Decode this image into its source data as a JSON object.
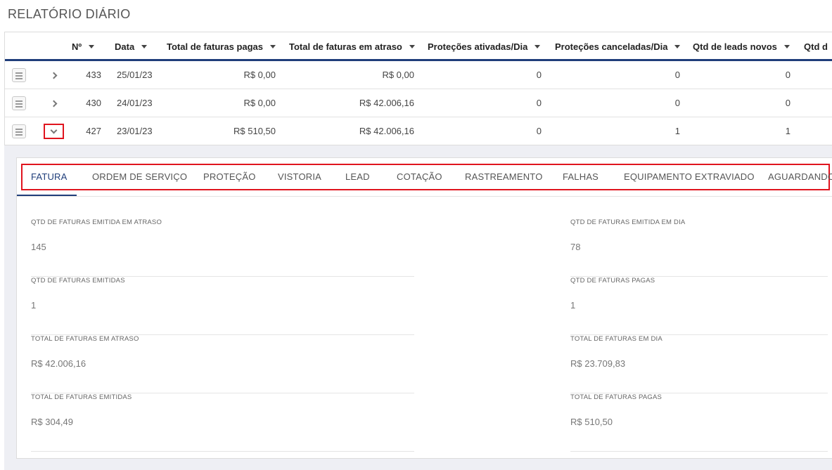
{
  "page": {
    "title": "RELATÓRIO DIÁRIO"
  },
  "table": {
    "columns": [
      "Nº",
      "Data",
      "Total de faturas pagas",
      "Total de faturas em atraso",
      "Proteções ativadas/Dia",
      "Proteções canceladas/Dia",
      "Qtd de leads novos",
      "Qtd d"
    ],
    "rows": [
      {
        "num": "433",
        "date": "25/01/23",
        "paid": "R$ 0,00",
        "late": "R$ 0,00",
        "activated": "0",
        "canceled": "0",
        "leads": "0",
        "expanded": false
      },
      {
        "num": "430",
        "date": "24/01/23",
        "paid": "R$ 0,00",
        "late": "R$ 42.006,16",
        "activated": "0",
        "canceled": "0",
        "leads": "0",
        "expanded": false
      },
      {
        "num": "427",
        "date": "23/01/23",
        "paid": "R$ 510,50",
        "late": "R$ 42.006,16",
        "activated": "0",
        "canceled": "1",
        "leads": "1",
        "expanded": true
      }
    ],
    "icons": {
      "row_menu": "hamburger-icon",
      "collapsed": "chevron-right-icon",
      "expanded": "chevron-down-icon",
      "sort": "caret-down-icon"
    }
  },
  "detail": {
    "tabs": [
      "FATURA",
      "ORDEM DE SERVIÇO",
      "PROTEÇÃO",
      "VISTORIA",
      "LEAD",
      "COTAÇÃO",
      "RASTREAMENTO",
      "FALHAS",
      "EQUIPAMENTO EXTRAVIADO",
      "AGUARDANDO"
    ],
    "active_tab": "FATURA",
    "fields_left": [
      {
        "label": "QTD DE FATURAS EMITIDA EM ATRASO",
        "value": "145"
      },
      {
        "label": "QTD DE FATURAS EMITIDAS",
        "value": "1"
      },
      {
        "label": "TOTAL DE FATURAS EM ATRASO",
        "value": "R$ 42.006,16"
      },
      {
        "label": "TOTAL DE FATURAS EMITIDAS",
        "value": "R$ 304,49"
      }
    ],
    "fields_right": [
      {
        "label": "QTD DE FATURAS EMITIDA EM DIA",
        "value": "78"
      },
      {
        "label": "QTD DE FATURAS PAGAS",
        "value": "1"
      },
      {
        "label": "TOTAL DE FATURAS EM DIA",
        "value": "R$ 23.709,83"
      },
      {
        "label": "TOTAL DE FATURAS PAGAS",
        "value": "R$ 510,50"
      }
    ]
  },
  "colors": {
    "accent": "#1f3d7a",
    "highlight": "#e0141e",
    "detail_background": "#eeeff4"
  }
}
